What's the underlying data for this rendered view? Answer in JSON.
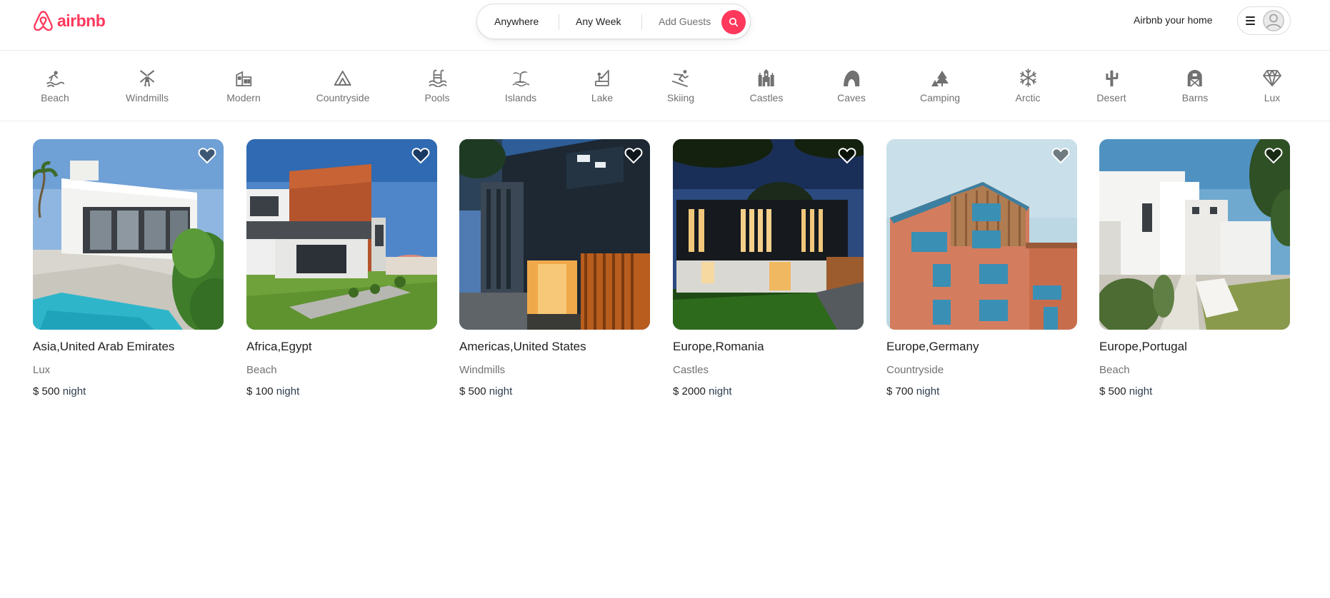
{
  "brand": {
    "name": "airbnb",
    "color": "#ff385c"
  },
  "search": {
    "anywhere": "Anywhere",
    "any_week": "Any Week",
    "add_guests": "Add Guests",
    "button_icon": "search-icon"
  },
  "header": {
    "host_link": "Airbnb your home",
    "menu_icon": "hamburger-icon",
    "avatar_icon": "user-avatar-icon"
  },
  "categories": [
    {
      "label": "Beach",
      "icon": "beach-icon"
    },
    {
      "label": "Windmills",
      "icon": "windmill-icon"
    },
    {
      "label": "Modern",
      "icon": "modern-house-icon"
    },
    {
      "label": "Countryside",
      "icon": "mountain-icon"
    },
    {
      "label": "Pools",
      "icon": "pool-icon"
    },
    {
      "label": "Islands",
      "icon": "island-icon"
    },
    {
      "label": "Lake",
      "icon": "lake-icon"
    },
    {
      "label": "Skiing",
      "icon": "skiing-icon"
    },
    {
      "label": "Castles",
      "icon": "castle-icon"
    },
    {
      "label": "Caves",
      "icon": "cave-icon"
    },
    {
      "label": "Camping",
      "icon": "camping-icon"
    },
    {
      "label": "Arctic",
      "icon": "snowflake-icon"
    },
    {
      "label": "Desert",
      "icon": "cactus-icon"
    },
    {
      "label": "Barns",
      "icon": "barn-icon"
    },
    {
      "label": "Lux",
      "icon": "diamond-icon"
    }
  ],
  "listings": [
    {
      "location": "Asia,United Arab Emirates",
      "category": "Lux",
      "price": "$ 500",
      "unit": "night"
    },
    {
      "location": "Africa,Egypt",
      "category": "Beach",
      "price": "$ 100",
      "unit": "night"
    },
    {
      "location": "Americas,United States",
      "category": "Windmills",
      "price": "$ 500",
      "unit": "night"
    },
    {
      "location": "Europe,Romania",
      "category": "Castles",
      "price": "$ 2000",
      "unit": "night"
    },
    {
      "location": "Europe,Germany",
      "category": "Countryside",
      "price": "$ 700",
      "unit": "night"
    },
    {
      "location": "Europe,Portugal",
      "category": "Beach",
      "price": "$ 500",
      "unit": "night"
    }
  ]
}
